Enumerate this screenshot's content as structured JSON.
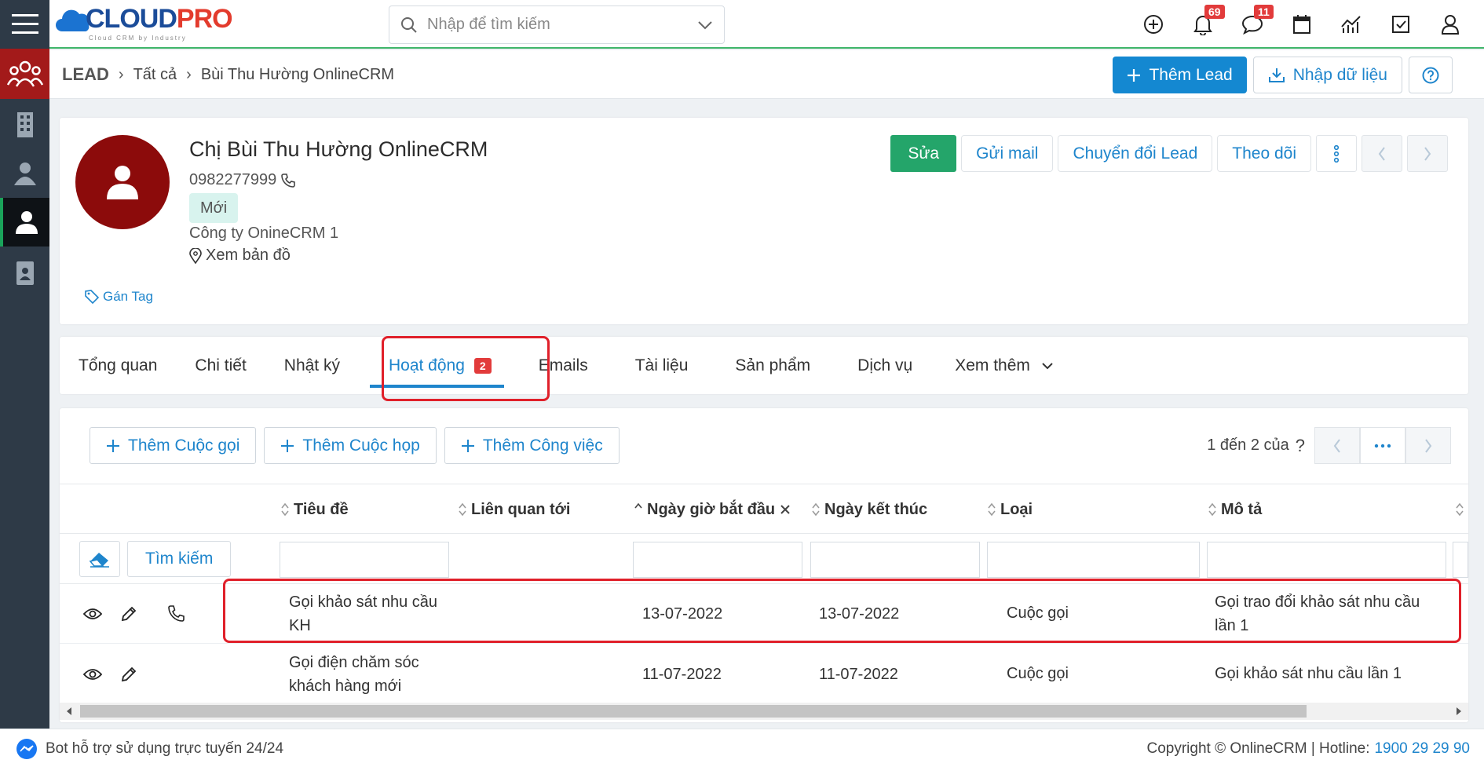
{
  "app": {
    "logo_main": "CLOUD",
    "logo_accent": "PRO",
    "logo_sub": "Cloud CRM by Industry",
    "search_placeholder": "Nhập để tìm kiếm",
    "notifications_count": "69",
    "messages_count": "11"
  },
  "breadcrumb": {
    "root": "LEAD",
    "level1": "Tất cả",
    "current": "Bùi Thu Hường OnlineCRM"
  },
  "header_actions": {
    "add_lead": "Thêm Lead",
    "import": "Nhập dữ liệu"
  },
  "profile": {
    "name": "Chị Bùi Thu Hường OnlineCRM",
    "phone": "0982277999",
    "status": "Mới",
    "company": "Công ty OnineCRM 1",
    "map_link": "Xem bản đồ",
    "tag_link": "Gán Tag",
    "actions": {
      "edit": "Sửa",
      "send_mail": "Gửi mail",
      "convert": "Chuyển đổi Lead",
      "follow": "Theo dõi"
    }
  },
  "tabs": {
    "overview": "Tổng quan",
    "detail": "Chi tiết",
    "log": "Nhật ký",
    "activity": "Hoạt động",
    "activity_count": "2",
    "emails": "Emails",
    "documents": "Tài liệu",
    "products": "Sản phẩm",
    "services": "Dịch vụ",
    "more": "Xem thêm"
  },
  "activity": {
    "add_call": "Thêm Cuộc gọi",
    "add_meeting": "Thêm Cuộc họp",
    "add_task": "Thêm Công việc",
    "pager": "1 đến 2 của",
    "pager_help": "?",
    "search_button": "Tìm kiếm",
    "columns": {
      "title": "Tiêu đề",
      "related": "Liên quan tới",
      "start": "Ngày giờ bắt đầu",
      "end": "Ngày kết thúc",
      "type": "Loại",
      "desc": "Mô tả"
    },
    "rows": [
      {
        "title_line1": "Gọi khảo sát nhu cầu",
        "title_line2": "KH",
        "start": "13-07-2022",
        "end": "13-07-2022",
        "type": "Cuộc gọi",
        "desc_line1": "Gọi trao đổi khảo sát nhu cầu",
        "desc_line2": "lần 1"
      },
      {
        "title_line1": "Gọi điện chăm sóc",
        "title_line2": "khách hàng mới",
        "start": "11-07-2022",
        "end": "11-07-2022",
        "type": "Cuộc gọi",
        "desc_line1": "Gọi khảo sát nhu cầu lần 1",
        "desc_line2": ""
      }
    ]
  },
  "footer": {
    "bot": "Bot hỗ trợ sử dụng trực tuyến 24/24",
    "copyright": "Copyright © OnlineCRM | Hotline:",
    "hotline": "1900 29 29 90"
  },
  "colors": {
    "primary": "#1488d1",
    "green": "#24a56a",
    "lead_red": "#a31a1a",
    "highlight": "#e0202a"
  }
}
